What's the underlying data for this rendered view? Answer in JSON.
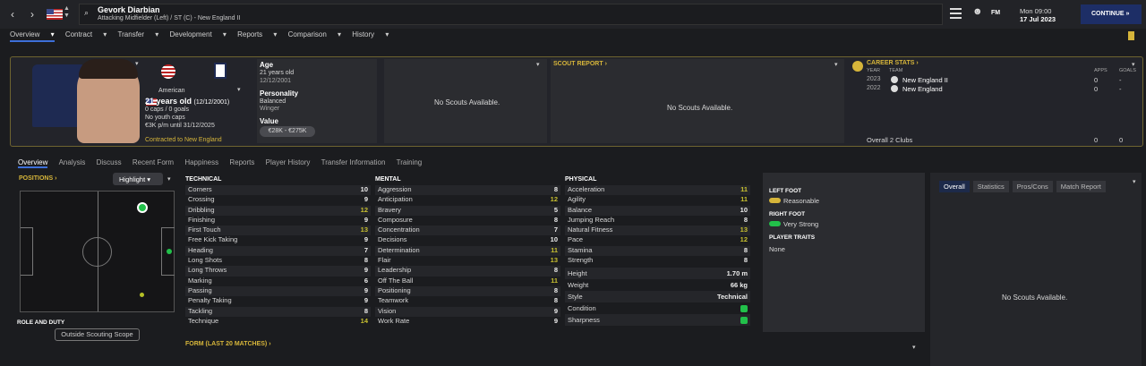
{
  "header": {
    "player_name": "Gevork Diarbian",
    "player_role": "Attacking Midfielder (Left) / ST (C) - New England II",
    "date_time": "Mon 09:00",
    "date": "17 Jul 2023",
    "continue_label": "CONTINUE",
    "fm_label": "FM"
  },
  "menu": [
    "Overview",
    "Contract",
    "Transfer",
    "Development",
    "Reports",
    "Comparison",
    "History"
  ],
  "profile": {
    "nationality": "American",
    "age_line": "21 years old",
    "dob_paren": "(12/12/2001)",
    "caps": "0 caps / 0 goals",
    "youth_caps": "No youth caps",
    "wage": "€3K p/m until 31/12/2025",
    "contracted": "Contracted to New England"
  },
  "info": {
    "age_label": "Age",
    "age_value": "21 years old",
    "dob": "12/12/2001",
    "personality_label": "Personality",
    "personality_value": "Balanced",
    "position_text": "Winger",
    "value_label": "Value",
    "value_value": "€28K - €275K"
  },
  "scouts": {
    "none1": "No Scouts Available.",
    "report_title": "SCOUT REPORT",
    "none2": "No Scouts Available.",
    "none3": "No Scouts Available."
  },
  "career": {
    "title": "CAREER STATS",
    "col_year": "YEAR",
    "col_team": "TEAM",
    "col_apps": "APPS",
    "col_goals": "GOALS",
    "rows": [
      {
        "year": "2023",
        "team": "New England II",
        "apps": "0",
        "goals": "-"
      },
      {
        "year": "2022",
        "team": "New England",
        "apps": "0",
        "goals": "-"
      }
    ],
    "overall_label": "Overall 2 Clubs",
    "overall_apps": "0",
    "overall_goals": "0"
  },
  "subtabs": [
    "Overview",
    "Analysis",
    "Discuss",
    "Recent Form",
    "Happiness",
    "Reports",
    "Player History",
    "Transfer Information",
    "Training"
  ],
  "positions": {
    "title": "POSITIONS",
    "dropdown": "Highlight",
    "role_title": "ROLE AND DUTY",
    "scope_button": "Outside Scouting Scope"
  },
  "technical": {
    "title": "TECHNICAL",
    "items": [
      {
        "n": "Corners",
        "v": "10"
      },
      {
        "n": "Crossing",
        "v": "9"
      },
      {
        "n": "Dribbling",
        "v": "12"
      },
      {
        "n": "Finishing",
        "v": "9"
      },
      {
        "n": "First Touch",
        "v": "13"
      },
      {
        "n": "Free Kick Taking",
        "v": "9"
      },
      {
        "n": "Heading",
        "v": "7"
      },
      {
        "n": "Long Shots",
        "v": "8"
      },
      {
        "n": "Long Throws",
        "v": "9"
      },
      {
        "n": "Marking",
        "v": "6"
      },
      {
        "n": "Passing",
        "v": "9"
      },
      {
        "n": "Penalty Taking",
        "v": "9"
      },
      {
        "n": "Tackling",
        "v": "8"
      },
      {
        "n": "Technique",
        "v": "14"
      }
    ]
  },
  "mental": {
    "title": "MENTAL",
    "items": [
      {
        "n": "Aggression",
        "v": "8"
      },
      {
        "n": "Anticipation",
        "v": "12"
      },
      {
        "n": "Bravery",
        "v": "5"
      },
      {
        "n": "Composure",
        "v": "8"
      },
      {
        "n": "Concentration",
        "v": "7"
      },
      {
        "n": "Decisions",
        "v": "10"
      },
      {
        "n": "Determination",
        "v": "11"
      },
      {
        "n": "Flair",
        "v": "13"
      },
      {
        "n": "Leadership",
        "v": "8"
      },
      {
        "n": "Off The Ball",
        "v": "11"
      },
      {
        "n": "Positioning",
        "v": "8"
      },
      {
        "n": "Teamwork",
        "v": "8"
      },
      {
        "n": "Vision",
        "v": "9"
      },
      {
        "n": "Work Rate",
        "v": "9"
      }
    ]
  },
  "physical": {
    "title": "PHYSICAL",
    "items": [
      {
        "n": "Acceleration",
        "v": "11"
      },
      {
        "n": "Agility",
        "v": "11"
      },
      {
        "n": "Balance",
        "v": "10"
      },
      {
        "n": "Jumping Reach",
        "v": "8"
      },
      {
        "n": "Natural Fitness",
        "v": "13"
      },
      {
        "n": "Pace",
        "v": "12"
      },
      {
        "n": "Stamina",
        "v": "8"
      },
      {
        "n": "Strength",
        "v": "8"
      }
    ],
    "extra": [
      {
        "n": "Height",
        "v": "1.70 m"
      },
      {
        "n": "Weight",
        "v": "66 kg"
      },
      {
        "n": "Style",
        "v": "Technical"
      },
      {
        "n": "Condition",
        "v": ""
      },
      {
        "n": "Sharpness",
        "v": ""
      }
    ]
  },
  "feet": {
    "left_title": "LEFT FOOT",
    "left_value": "Reasonable",
    "right_title": "RIGHT FOOT",
    "right_value": "Very Strong",
    "traits_title": "PLAYER TRAITS",
    "traits_value": "None"
  },
  "form": {
    "title": "FORM (LAST 20 MATCHES)"
  },
  "rightpanel": {
    "tabs": [
      "Overall",
      "Statistics",
      "Pros/Cons",
      "Match Report"
    ]
  },
  "colors": {
    "accent": "#3d6fd8",
    "gold": "#d6b53a",
    "highlight": "#c8c030",
    "green": "#22c04a"
  }
}
